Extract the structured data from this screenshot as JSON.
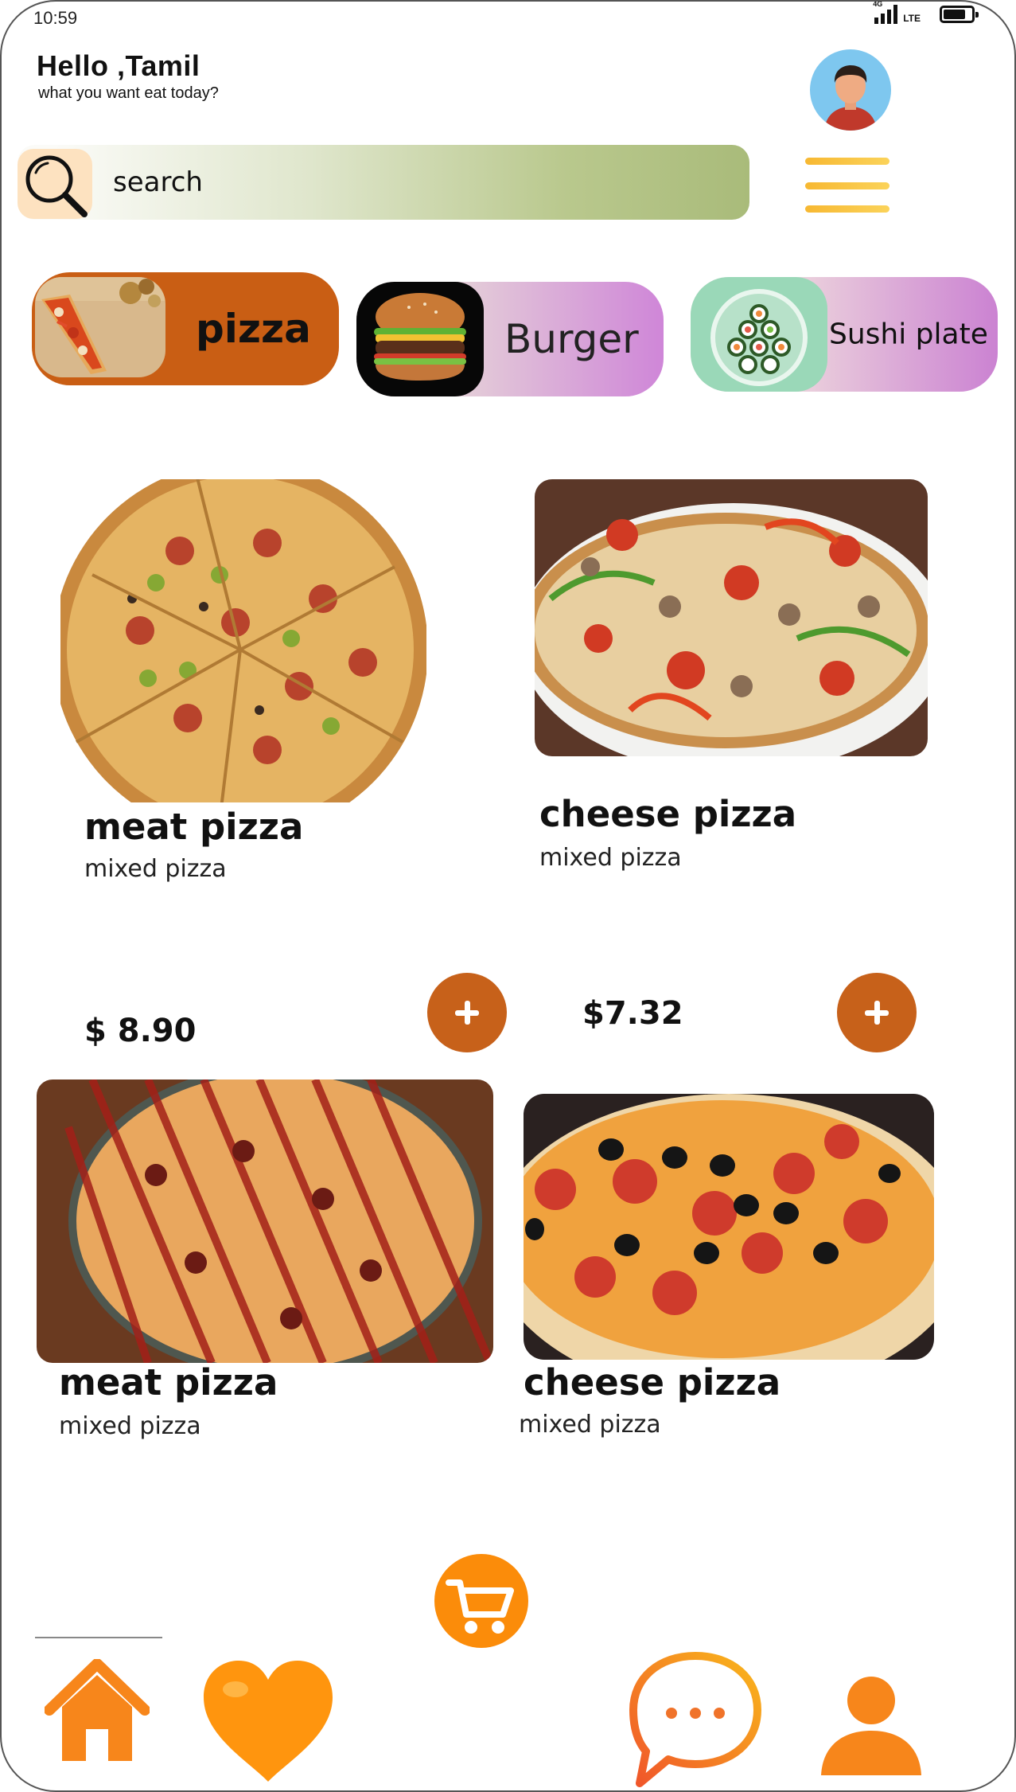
{
  "status_bar": {
    "time": "10:59",
    "network": "4G",
    "signal_type": "LTE",
    "battery_level": 0.8
  },
  "greeting": {
    "title": "Hello ,Tamil",
    "subtitle": "what you want eat today?"
  },
  "search": {
    "placeholder": "search"
  },
  "categories": [
    {
      "label": "pizza",
      "icon": "pizza-slice-image",
      "color": "#c95e14"
    },
    {
      "label": "Burger",
      "icon": "burger-image",
      "color": "#cf86d8"
    },
    {
      "label": "Sushi plate",
      "icon": "sushi-plate-image",
      "color": "#9ad8b8"
    }
  ],
  "products": [
    {
      "name": "meat pizza",
      "subtitle": "mixed pizza",
      "price": "$ 8.90"
    },
    {
      "name": "cheese pizza",
      "subtitle": "mixed pizza",
      "price": "$7.32"
    },
    {
      "name": "meat pizza",
      "subtitle": "mixed pizza"
    },
    {
      "name": "cheese pizza",
      "subtitle": "mixed pizza"
    }
  ],
  "bottom_nav": {
    "items": [
      "home-icon",
      "heart-icon",
      "chat-icon",
      "profile-icon"
    ],
    "fab": "cart-icon",
    "accent": "#fb8c0a"
  },
  "colors": {
    "add_button": "#c7611a",
    "menu_icon": "#f7b832"
  }
}
